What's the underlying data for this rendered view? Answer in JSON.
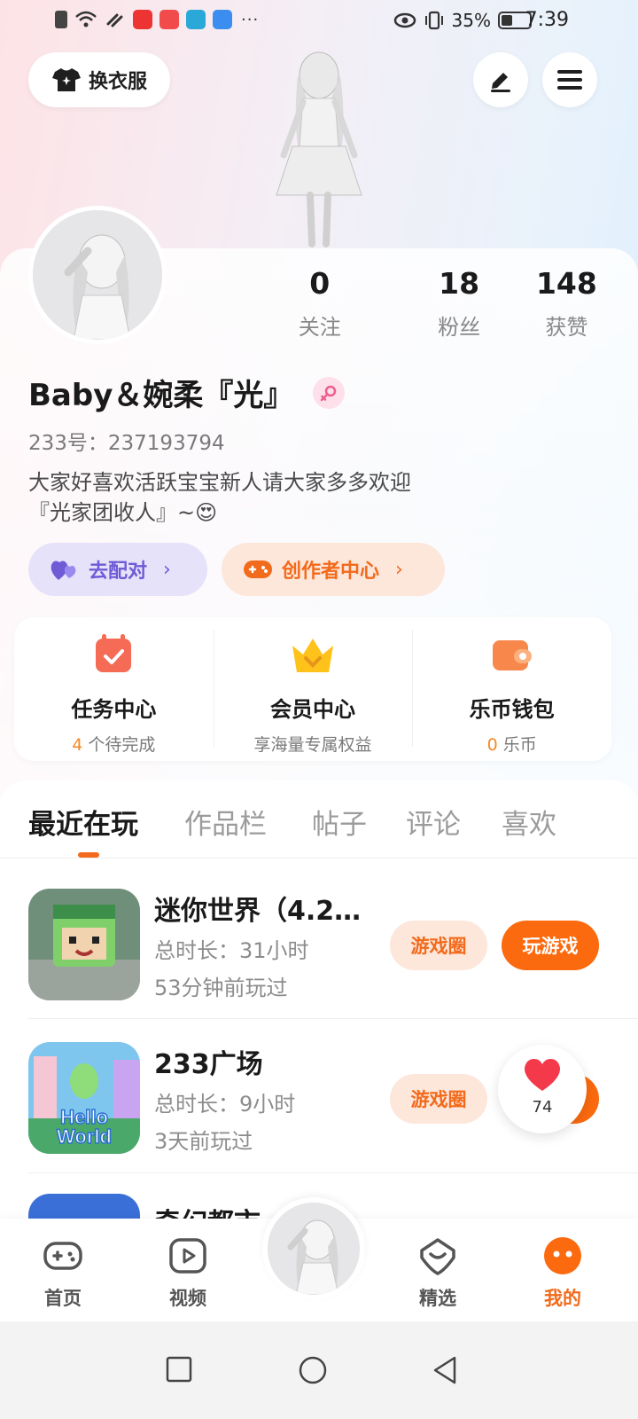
{
  "status_bar": {
    "battery_percent": "35%",
    "time": "7:39",
    "battery_level": 0.35
  },
  "header": {
    "outfit_label": "换衣服"
  },
  "profile": {
    "nickname": "Baby＆婉柔『光』",
    "uid": "233号：237193794",
    "bio_line1": "大家好喜欢活跃宝宝新人请大家多多欢迎",
    "bio_line2": "『光家团收人』~😍",
    "stats": [
      {
        "value": "0",
        "label": "关注"
      },
      {
        "value": "18",
        "label": "粉丝"
      },
      {
        "value": "148",
        "label": "获赞"
      }
    ],
    "match_label": "去配对",
    "creator_label": "创作者中心"
  },
  "quick": [
    {
      "title": "任务中心",
      "count": "4",
      "sub": " 个待完成"
    },
    {
      "title": "会员中心",
      "count": "",
      "sub": "享海量专属权益"
    },
    {
      "title": "乐币钱包",
      "count": "0",
      "sub": " 乐币"
    }
  ],
  "tabs": [
    "最近在玩",
    "作品栏",
    "帖子",
    "评论",
    "喜欢"
  ],
  "games": [
    {
      "name": "迷你世界（4.25...",
      "duration": "总时长：31小时",
      "last_played": "53分钟前玩过"
    },
    {
      "name": "233广场",
      "duration": "总时长：9小时",
      "last_played": "3天前玩过"
    },
    {
      "name": "奇幻都市",
      "duration": "",
      "last_played": ""
    }
  ],
  "game_buttons": {
    "circle": "游戏圈",
    "play": "玩游戏"
  },
  "like_bubble": {
    "count": "74"
  },
  "bottom_nav": [
    {
      "label": "首页"
    },
    {
      "label": "视频"
    },
    {
      "label": "精选"
    },
    {
      "label": "我的"
    }
  ],
  "colors": {
    "accent": "#f26a1b",
    "match_purple": "#6f5bd6"
  }
}
